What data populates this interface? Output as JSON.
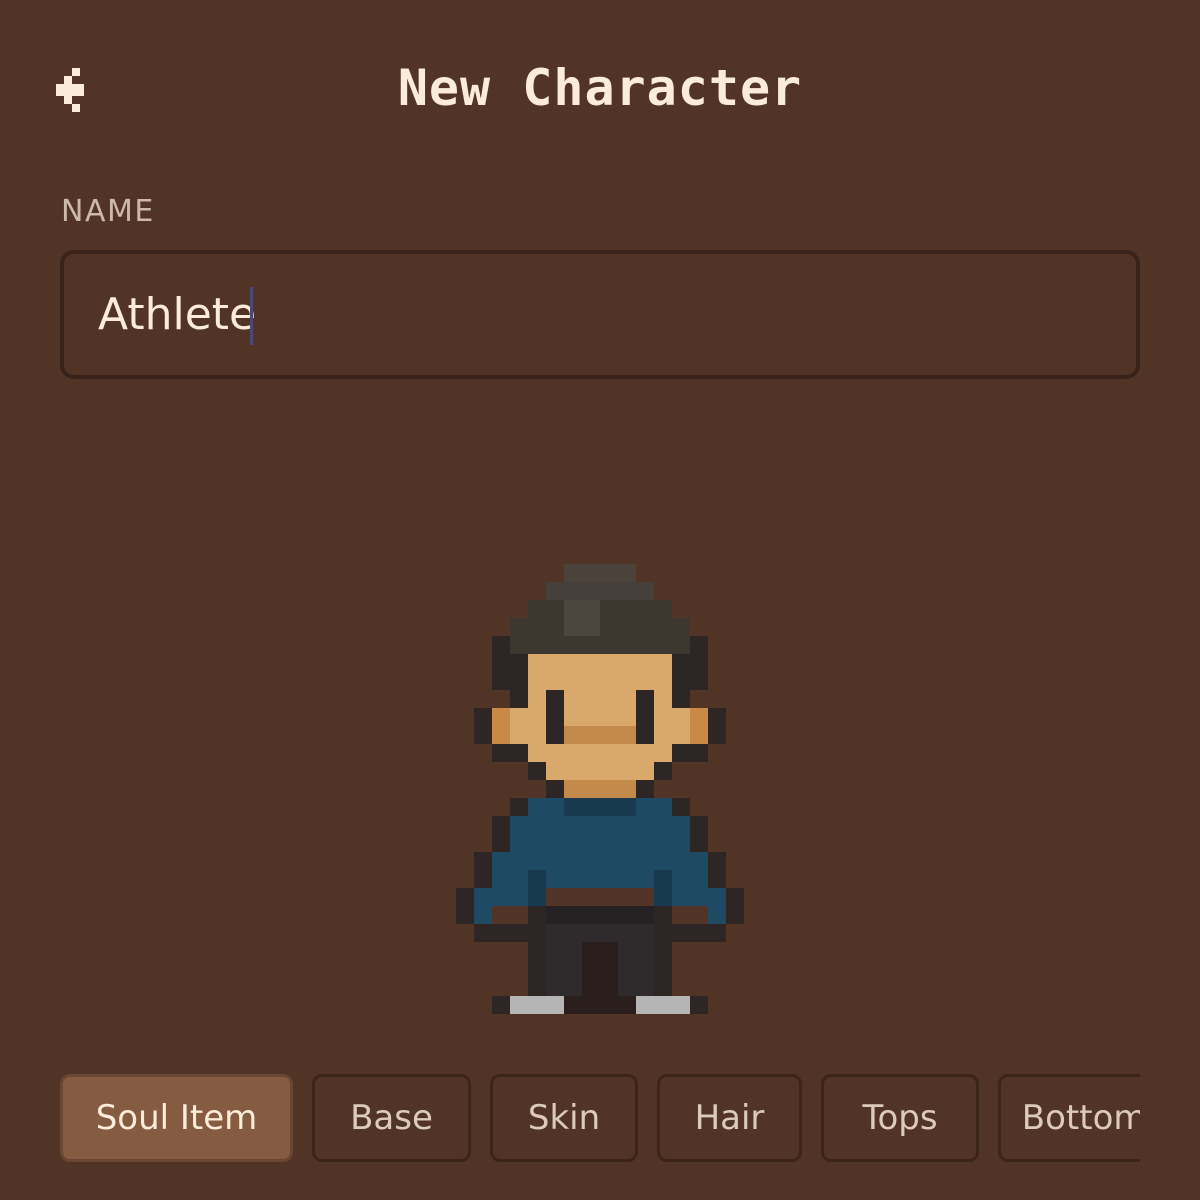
{
  "header": {
    "title": "New Character",
    "back_icon": "chevron-left-icon"
  },
  "name_field": {
    "label": "NAME",
    "value": "Athlete"
  },
  "character_preview": {
    "sprite": "pixel-character-sprite",
    "hair_color": "#3e3730",
    "skin_color": "#dba86c",
    "top_color": "#1f4a63",
    "bottom_color": "#2f2b2c"
  },
  "tabs": [
    {
      "label": "Soul Item",
      "active": true
    },
    {
      "label": "Base",
      "active": false
    },
    {
      "label": "Skin",
      "active": false
    },
    {
      "label": "Hair",
      "active": false
    },
    {
      "label": "Tops",
      "active": false
    },
    {
      "label": "Bottoms",
      "active": false
    }
  ],
  "colors": {
    "background": "#513426",
    "accent_tab": "#855c42",
    "text_primary": "#fbebd9",
    "text_muted": "#cdb9ab"
  }
}
